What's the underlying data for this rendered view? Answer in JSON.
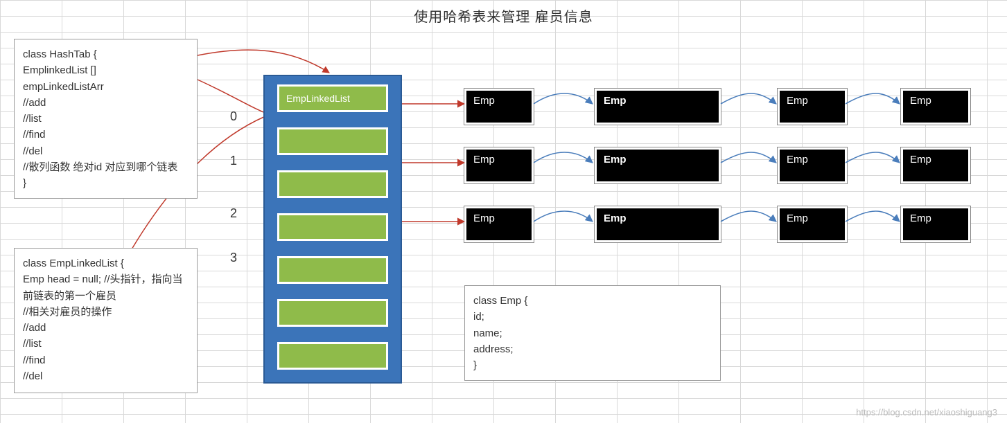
{
  "title": "使用哈希表来管理 雇员信息",
  "hashtab_box": "class HashTab  {\n  EmplinkedList []\nempLinkedListArr\n //add\n  //list\n //find\n //del\n //散列函数 绝对id 对应到哪个链表\n }",
  "emplinkedlist_box": "class  EmpLinkedList {\n  Emp head = null; //头指针，指向当前链表的第一个雇员\n //相关对雇员的操作\n //add\n //list\n//find\n//del",
  "emp_class_box": "class Emp {\n id;\n  name;\n  address;\n  }",
  "indices": [
    "0",
    "1",
    "2",
    "3"
  ],
  "slot_label": "EmpLinkedList",
  "emp_label": "Emp",
  "colors": {
    "array_bg": "#3b74b9",
    "slot_bg": "#8fbb4a",
    "emp_bg": "#000000"
  },
  "watermark": "https://blog.csdn.net/xiaoshiguang3"
}
